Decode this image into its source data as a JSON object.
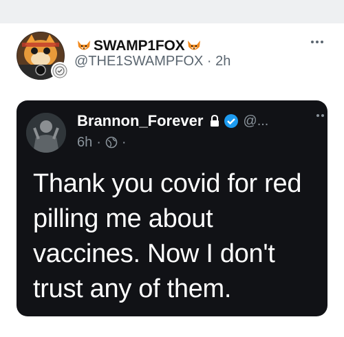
{
  "tweet": {
    "display_name": "SWAMP1FOX",
    "handle": "@THE1SWAMPFOX",
    "separator": "·",
    "time": "2h",
    "icons": {
      "avatar": "fox-mask-avatar",
      "name_left": "fox-emoji-icon",
      "name_right": "fox-emoji-icon",
      "more": "more-dots-icon"
    }
  },
  "embedded_screenshot": {
    "display_name": "Brannon_Forever",
    "handle": "@...",
    "time": "6h",
    "dot1": "·",
    "dot2": "·",
    "icons": {
      "lock": "lock-icon",
      "verified": "verified-badge-icon",
      "globe": "globe-icon",
      "more": "more-dots-icon"
    },
    "text": "Thank you covid for red pilling me about vaccines. Now I don't trust any of them."
  },
  "colors": {
    "background": "#ffffff",
    "top_band": "#eef0f2",
    "card_background": "#111216",
    "verified_blue": "#1d9bf0",
    "muted": "#5b6670"
  }
}
